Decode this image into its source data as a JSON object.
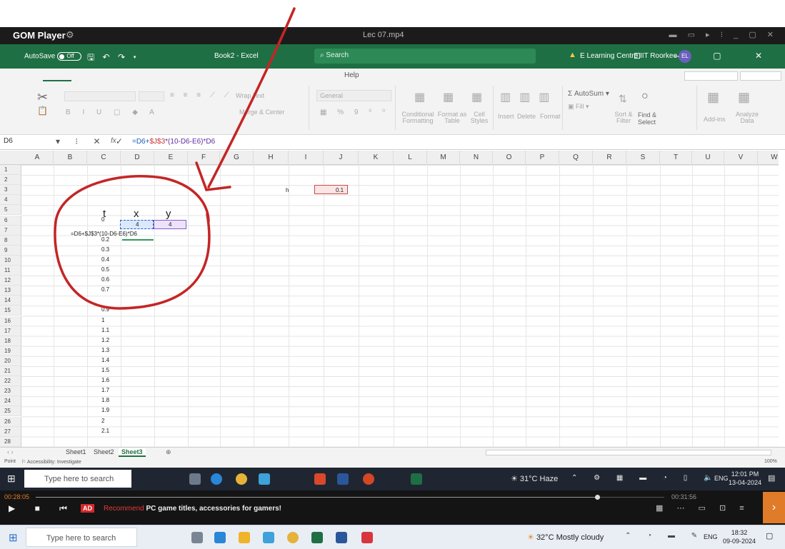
{
  "gom": {
    "app_name": "GOM Player",
    "file_name": "Lec 07.mp4",
    "elapsed": "00:28:05",
    "total": "00:31:56",
    "ad_badge": "AD",
    "ad_text": "Recommend",
    "ad_text_rest": "PC game titles, accessories for gamers!"
  },
  "excel": {
    "autosave_label": "AutoSave",
    "autosave_state": "Off",
    "workbook_title": "Book2 - Excel",
    "search_placeholder": "Search",
    "account_name": "E Learning Centre IIT Roorkee",
    "account_initials": "EL",
    "help_tab": "Help",
    "ribbon": {
      "wrap_text": "Wrap Text",
      "merge_center": "Merge & Center",
      "number_format": "General",
      "conditional_formatting": "Conditional Formatting",
      "format_as_table": "Format as Table",
      "cell_styles": "Cell Styles",
      "insert": "Insert",
      "delete": "Delete",
      "format": "Format",
      "autosum": "AutoSum",
      "fill": "Fill",
      "sort_filter": "Sort & Filter",
      "find_select_line1": "Find &",
      "find_select_line2": "Select",
      "add_ins": "Add-ins",
      "analyze_data": "Analyze Data"
    },
    "name_box": "D6",
    "formula_ref1": "=D6+",
    "formula_ref2": "$J$3",
    "formula_rest": "*(10-D6-E6)*D6",
    "columns": [
      "A",
      "B",
      "C",
      "D",
      "E",
      "F",
      "G",
      "H",
      "I",
      "J",
      "K",
      "L",
      "M",
      "N",
      "O",
      "P",
      "Q",
      "R",
      "S",
      "T",
      "U",
      "V",
      "W"
    ],
    "rows": [
      "1",
      "2",
      "3",
      "4",
      "5",
      "6",
      "7",
      "8",
      "9",
      "10",
      "11",
      "12",
      "13",
      "14",
      "15",
      "16",
      "17",
      "18",
      "19",
      "20",
      "21",
      "22",
      "23",
      "24",
      "25",
      "26",
      "27",
      "28"
    ],
    "cells": {
      "h_label": "h",
      "h_value": "0.1",
      "header_t": "t",
      "header_x": "x",
      "header_y": "y",
      "x0": "4",
      "y0": "4",
      "editing_formula": "=D6+$J$3*(10-D6-E6)*D6",
      "t_values": [
        "0",
        "0.2",
        "0.3",
        "0.4",
        "0.5",
        "0.6",
        "0.7",
        "0.9",
        "1",
        "1.1",
        "1.2",
        "1.3",
        "1.4",
        "1.5",
        "1.6",
        "1.7",
        "1.8",
        "1.9",
        "2",
        "2.1"
      ]
    },
    "sheets": [
      "Sheet1",
      "Sheet2",
      "Sheet3"
    ],
    "active_sheet": "Sheet3",
    "status_mode": "Point",
    "accessibility": "Accessibility: Investigate",
    "zoom": "100%"
  },
  "taskbar_video": {
    "search_placeholder": "Type here to search",
    "weather": "31°C Haze",
    "lang": "ENG",
    "time": "12:01 PM",
    "date": "13-04-2024"
  },
  "taskbar_host": {
    "search_placeholder": "Type here to search",
    "weather": "32°C Mostly cloudy",
    "lang": "ENG",
    "time": "18:32",
    "date": "09-09-2024"
  },
  "colors": {
    "excel_green": "#1e6f43",
    "ink_red": "#cc2b2b",
    "gom_bg": "#141414"
  }
}
